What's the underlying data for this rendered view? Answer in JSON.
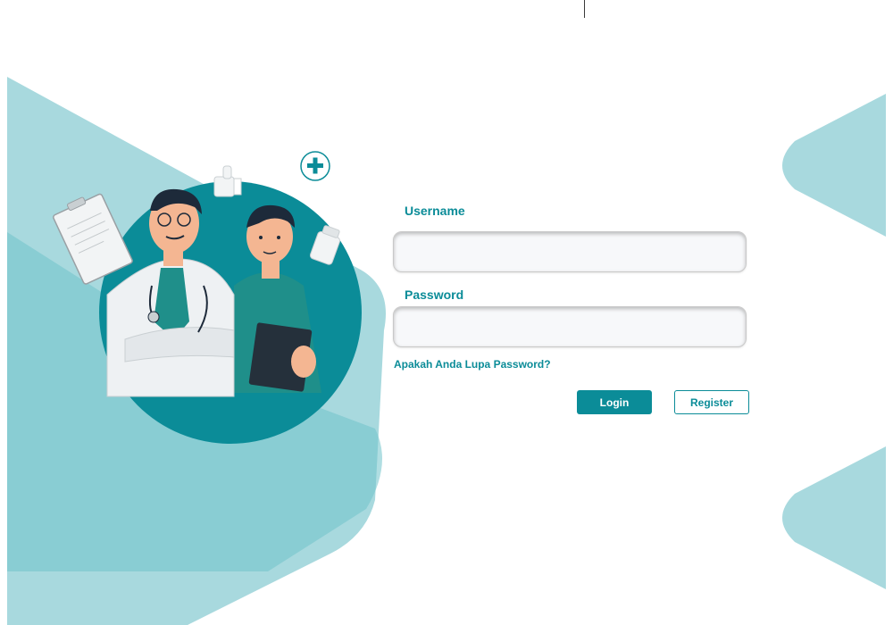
{
  "form": {
    "username_label": "Username",
    "username_value": "",
    "password_label": "Password",
    "password_value": "",
    "forgot_password": "Apakah Anda Lupa Password?",
    "login_label": "Login",
    "register_label": "Register"
  },
  "colors": {
    "accent": "#0b8c98",
    "background_shape": "#a8d9de",
    "background_shape_dark": "#6fc3cb"
  },
  "icons": [
    "plus-icon",
    "clipboard-icon",
    "thumbs-up-icon",
    "pill-bottle-icon"
  ]
}
